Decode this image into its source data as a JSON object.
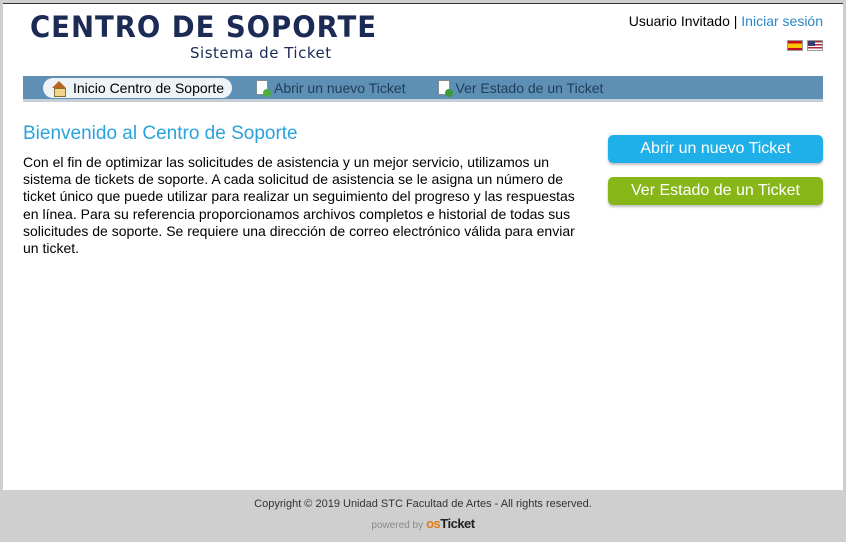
{
  "header": {
    "logo_title": "CENTRO DE SOPORTE",
    "logo_subtitle": "Sistema de Ticket",
    "user_label": "Usuario Invitado",
    "separator": "|",
    "login_link": "Iniciar sesión",
    "languages": [
      {
        "name": "es-flag-icon",
        "label": "Español"
      },
      {
        "name": "us-flag-icon",
        "label": "English"
      }
    ]
  },
  "nav": {
    "items": [
      {
        "label": "Inicio Centro de Soporte",
        "icon": "home-icon",
        "active": true
      },
      {
        "label": "Abrir un nuevo Ticket",
        "icon": "new-ticket-icon",
        "active": false
      },
      {
        "label": "Ver Estado de un Ticket",
        "icon": "ticket-status-icon",
        "active": false
      }
    ]
  },
  "main": {
    "title": "Bienvenido al Centro de Soporte",
    "body": "Con el fin de optimizar las solicitudes de asistencia y un mejor servicio, utilizamos un sistema de tickets de soporte. A cada solicitud de asistencia se le asigna un número de ticket único que puede utilizar para realizar un seguimiento del progreso y las respuestas en línea. Para su referencia proporcionamos archivos completos e historial de todas sus solicitudes de soporte. Se requiere una dirección de correo electrónico válida para enviar un ticket."
  },
  "sidebar": {
    "open_ticket_button": "Abrir un nuevo Ticket",
    "check_status_button": "Ver Estado de un Ticket"
  },
  "footer": {
    "copyright": "Copyright © 2019 Unidad STC Facultad de Artes - All rights reserved.",
    "powered_by": "powered by",
    "brand_os": "os",
    "brand_ticket": "Ticket"
  },
  "colors": {
    "accent_blue": "#1fb0ea",
    "accent_green": "#86b618",
    "nav_bar": "#5e8fb4",
    "title_blue": "#2aa2dc",
    "logo_navy": "#1b2b55"
  }
}
